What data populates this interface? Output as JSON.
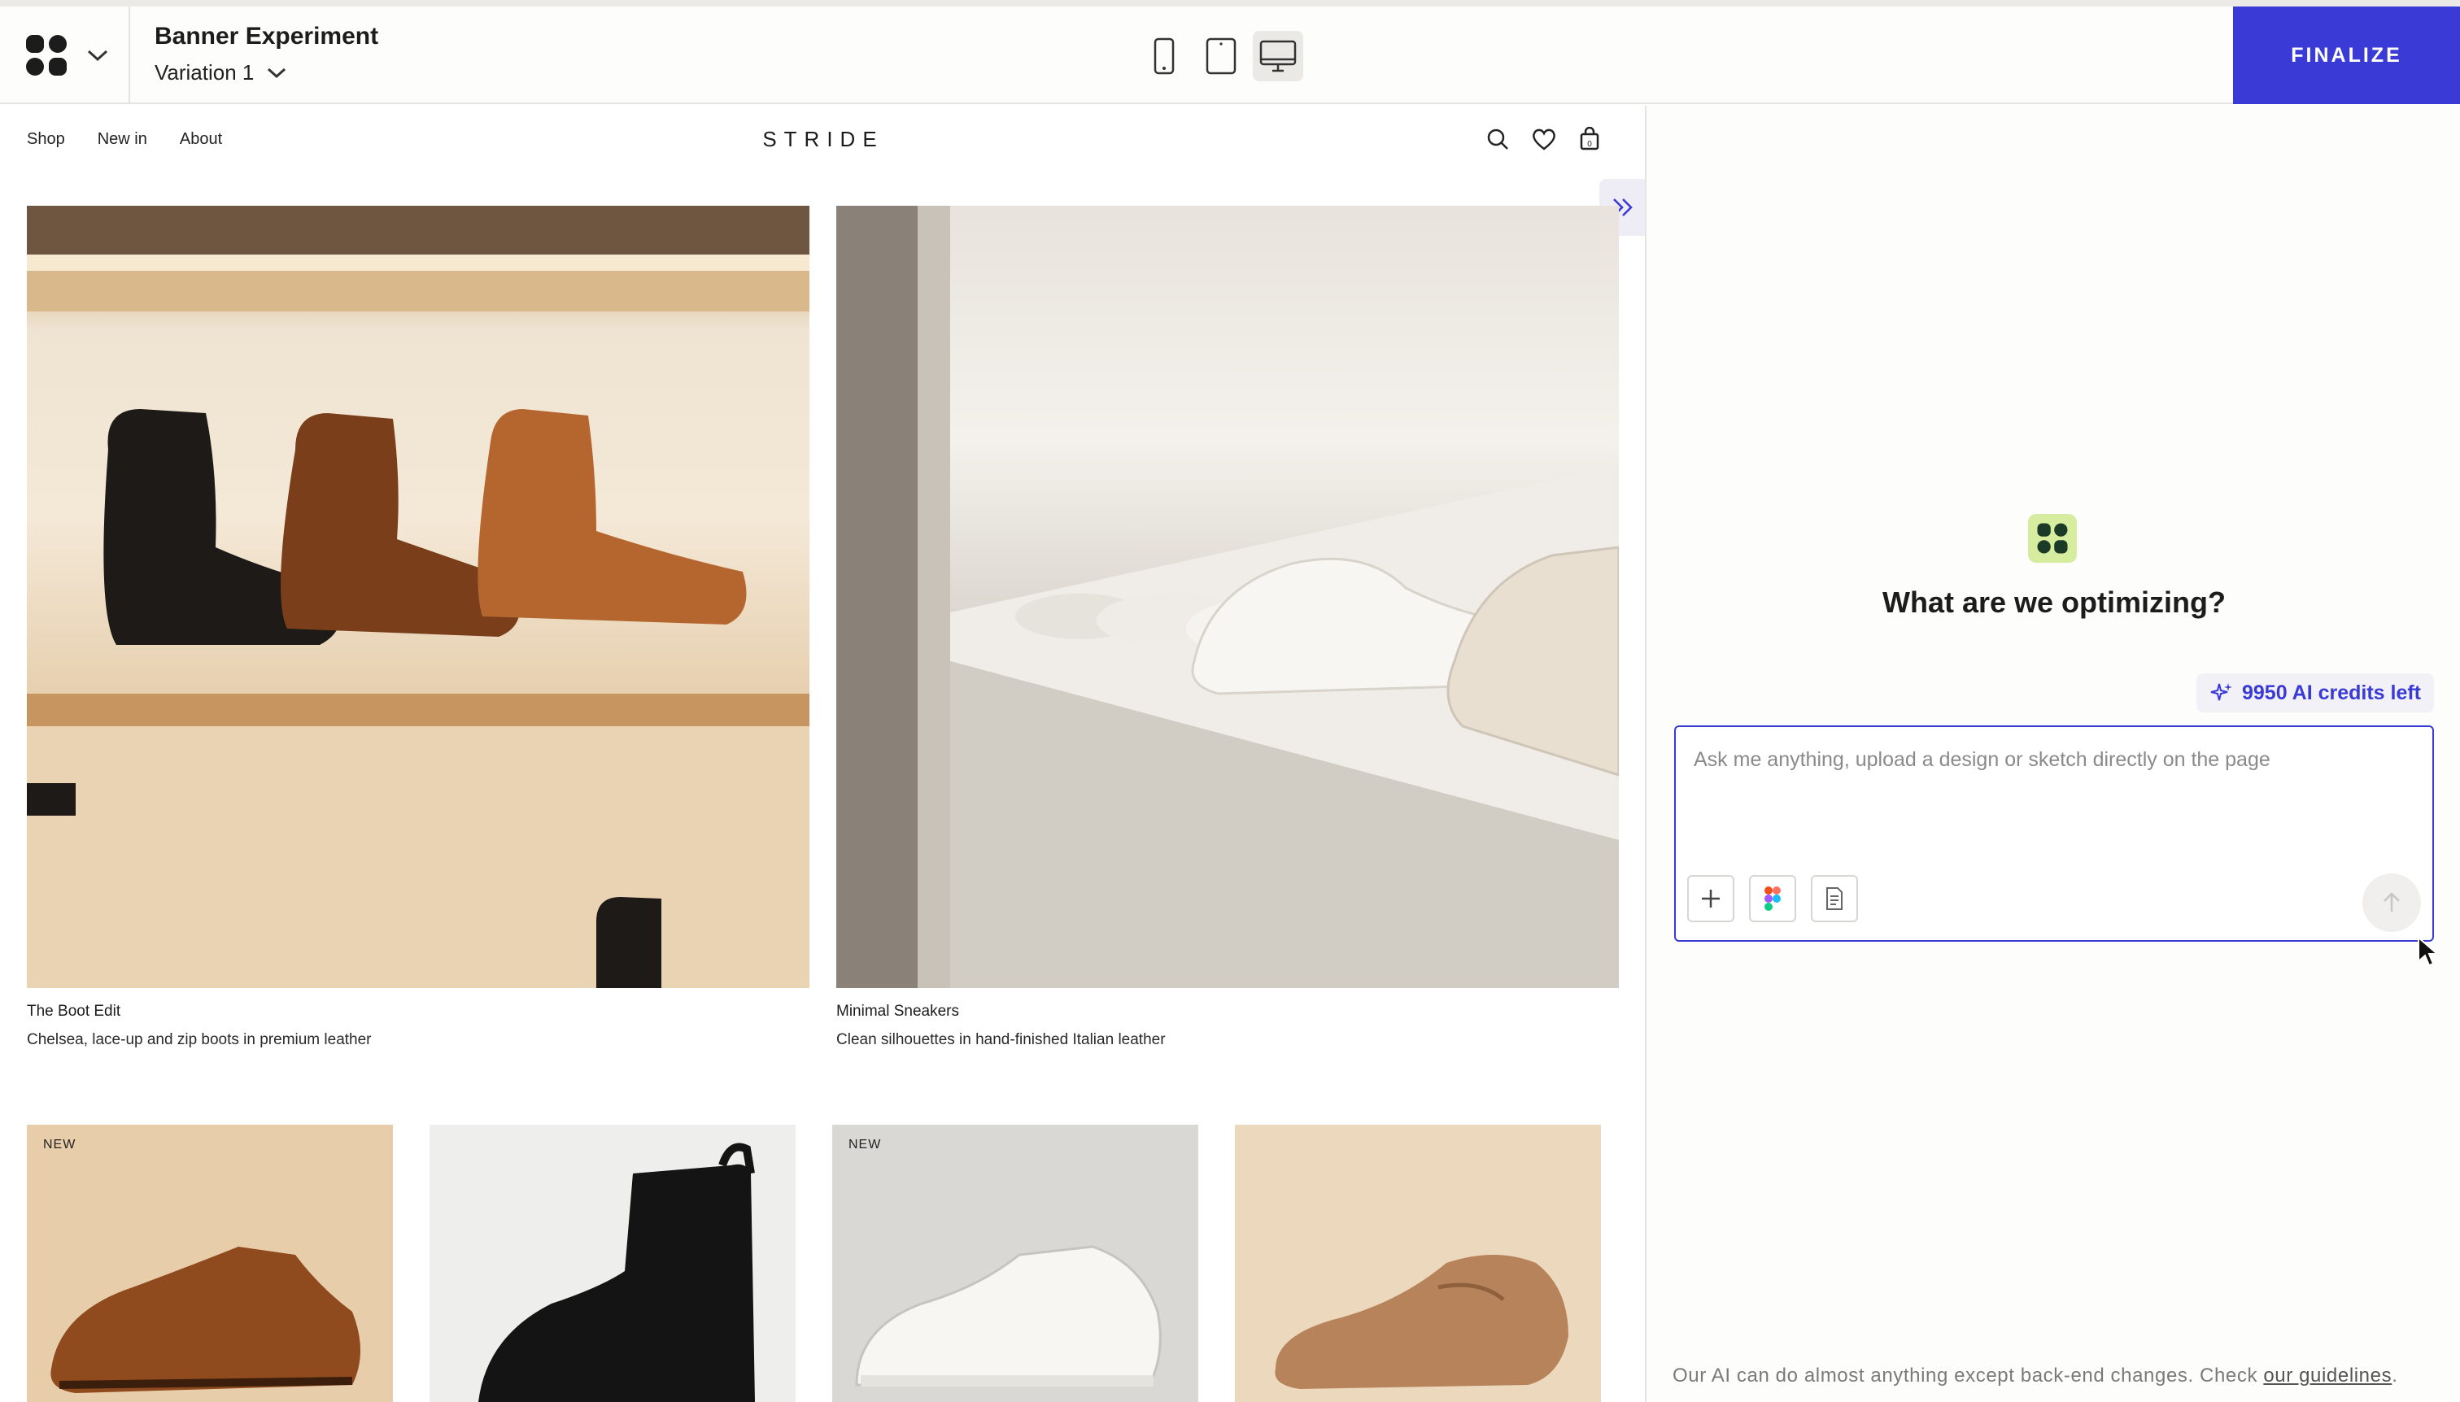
{
  "topbar": {
    "experiment_title": "Banner Experiment",
    "variation_label": "Variation 1",
    "finalize_label": "FINALIZE",
    "devices": [
      "mobile",
      "tablet",
      "desktop"
    ],
    "active_device": "desktop"
  },
  "site": {
    "nav": [
      "Shop",
      "New in",
      "About"
    ],
    "brand": "STRIDE",
    "icons": [
      "search-icon",
      "heart-icon",
      "bag-icon"
    ],
    "heroes": [
      {
        "title": "The Boot Edit",
        "subtitle": "Chelsea, lace-up and zip boots in premium leather"
      },
      {
        "title": "Minimal Sneakers",
        "subtitle": "Clean silhouettes in hand-finished Italian leather"
      }
    ],
    "grid": [
      {
        "badge": "NEW",
        "product": "oxford-shoe"
      },
      {
        "badge": "",
        "product": "chelsea-boot"
      },
      {
        "badge": "NEW",
        "product": "white-sneaker"
      },
      {
        "badge": "",
        "product": "suede-loafer"
      }
    ]
  },
  "panel": {
    "question": "What are we optimizing?",
    "credits": "9950 AI credits left",
    "input_placeholder": "Ask me anything, upload a design or sketch directly on the page",
    "footer_text": "Our AI can do almost anything except back-end changes. Check ",
    "footer_link": "our guidelines",
    "footer_end": "."
  },
  "colors": {
    "accent": "#3a3ad6",
    "logo_bg": "#d6ec9e",
    "credits_bg": "#f1f1f7"
  }
}
